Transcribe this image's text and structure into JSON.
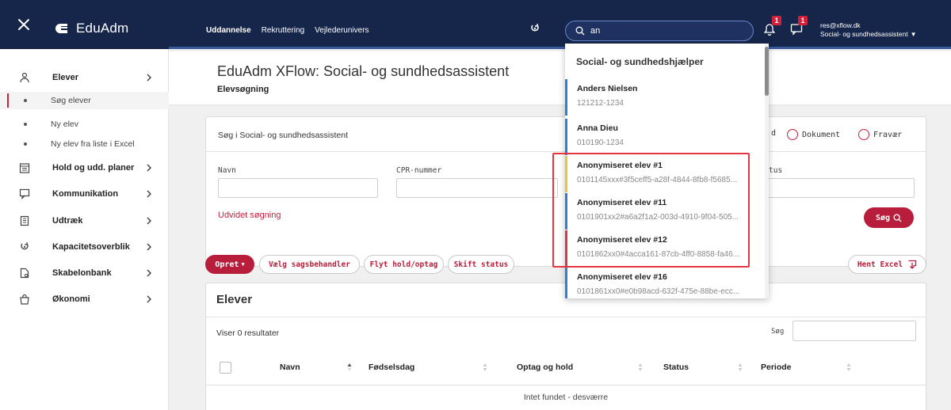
{
  "app": {
    "name": "EduAdm",
    "close_icon": "close-icon",
    "logo_icon": "eduadm-logo-icon"
  },
  "topnav": {
    "items": [
      "Uddannelse",
      "Rekruttering",
      "Vejlederunivers"
    ]
  },
  "search": {
    "value": "an",
    "icon": "search-icon"
  },
  "notifications": {
    "bell_count": "1",
    "chat_count": "1"
  },
  "user": {
    "email": "res@xflow.dk",
    "role": "Social- og sundhedsassistent"
  },
  "sidebar": {
    "items": [
      {
        "label": "Elever",
        "icon": "person-icon"
      },
      {
        "label": "Søg elever"
      },
      {
        "label": "Ny elev"
      },
      {
        "label": "Ny elev fra liste i Excel"
      },
      {
        "label": "Hold og udd. planer",
        "icon": "calendar-icon"
      },
      {
        "label": "Kommunikation",
        "icon": "chat-icon"
      },
      {
        "label": "Udtræk",
        "icon": "building-icon"
      },
      {
        "label": "Kapacitetsoverblik",
        "icon": "capacity-icon"
      },
      {
        "label": "Skabelonbank",
        "icon": "template-icon"
      },
      {
        "label": "Økonomi",
        "icon": "bag-icon"
      }
    ]
  },
  "page": {
    "title": "EduAdm XFlow: Social- og sundhedsassistent",
    "subtitle": "Elevsøgning"
  },
  "search_card": {
    "title": "Søg i Social- og sundhedsassistent",
    "radio_partial": "d",
    "radio_options": [
      "Dokument",
      "Fravær"
    ],
    "field_labels": {
      "navn": "Navn",
      "cpr": "CPR-nummer",
      "status_partial": "tus"
    },
    "expanded_search": "Udvidet søgning",
    "search_button": "Søg"
  },
  "actions": {
    "create": "Opret",
    "choose_handler": "Vælg sagsbehandler",
    "move": "Flyt hold/optag",
    "change_status": "Skift status",
    "excel": "Hent Excel"
  },
  "students": {
    "title": "Elever",
    "result_count": "Viser 0 resultater",
    "search_label": "Søg",
    "columns": [
      "Navn",
      "Fødselsdag",
      "Optag og hold",
      "Status",
      "Periode"
    ],
    "empty": "Intet fundet - desværre"
  },
  "dropdown": {
    "header": "Social- og sundhedshjælper",
    "items": [
      {
        "name": "Anders Nielsen",
        "id": "121212-1234",
        "accent": "#2c7ed6"
      },
      {
        "name": "Anna Dieu",
        "id": "010190-1234",
        "accent": "#2c7ed6"
      },
      {
        "name": "Anonymiseret elev #1",
        "id": "0101145xxx#3f5ceff5-a28f-4844-8fb8-f5685...",
        "accent": "#e8c53a"
      },
      {
        "name": "Anonymiseret elev #11",
        "id": "0101901xx2#a6a2f1a2-003d-4910-9f04-505...",
        "accent": "#2c7ed6"
      },
      {
        "name": "Anonymiseret elev #12",
        "id": "0101862xx0#4acca161-87cb-4ff0-8858-fa46...",
        "accent": "#d7384a"
      },
      {
        "name": "Anonymiseret elev #16",
        "id": "0101861xx0#e0b98acd-632f-475e-88be-ecc...",
        "accent": "#2c7ed6"
      }
    ]
  },
  "colors": {
    "topbar": "#16264a",
    "brand_red": "#b81d3b",
    "highlight": "#e53640"
  }
}
